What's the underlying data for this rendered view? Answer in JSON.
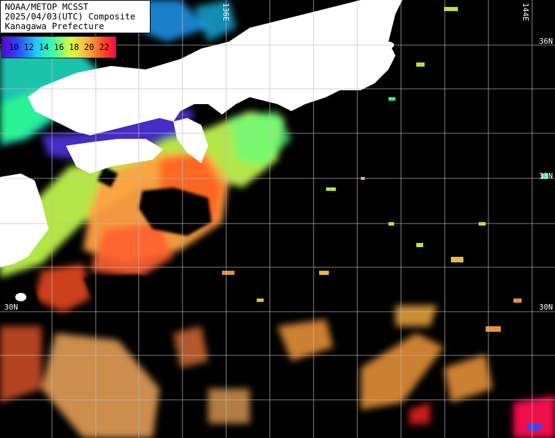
{
  "header": {
    "line1": "NOAA/METOP MCSST",
    "line2": "2025/04/03(UTC) Composite",
    "line3": "Kanagawa Prefecture"
  },
  "legend": {
    "ticks": [
      "10",
      "12",
      "14",
      "16",
      "18",
      "20",
      "22"
    ],
    "colors": [
      "#5a00c8",
      "#2a4cff",
      "#20c8ff",
      "#40ffa0",
      "#d8ff40",
      "#ffb040",
      "#ff4020",
      "#ff0060"
    ]
  },
  "graticule": {
    "lon_labels": [
      "136E",
      "144E"
    ],
    "lat_labels_right": [
      "36N",
      "33N",
      "30N"
    ],
    "lat_labels_left": [
      "30N"
    ]
  },
  "colors": {
    "land": "#ffffff",
    "cloud": "#000000",
    "grid": "#bdbdbd"
  }
}
